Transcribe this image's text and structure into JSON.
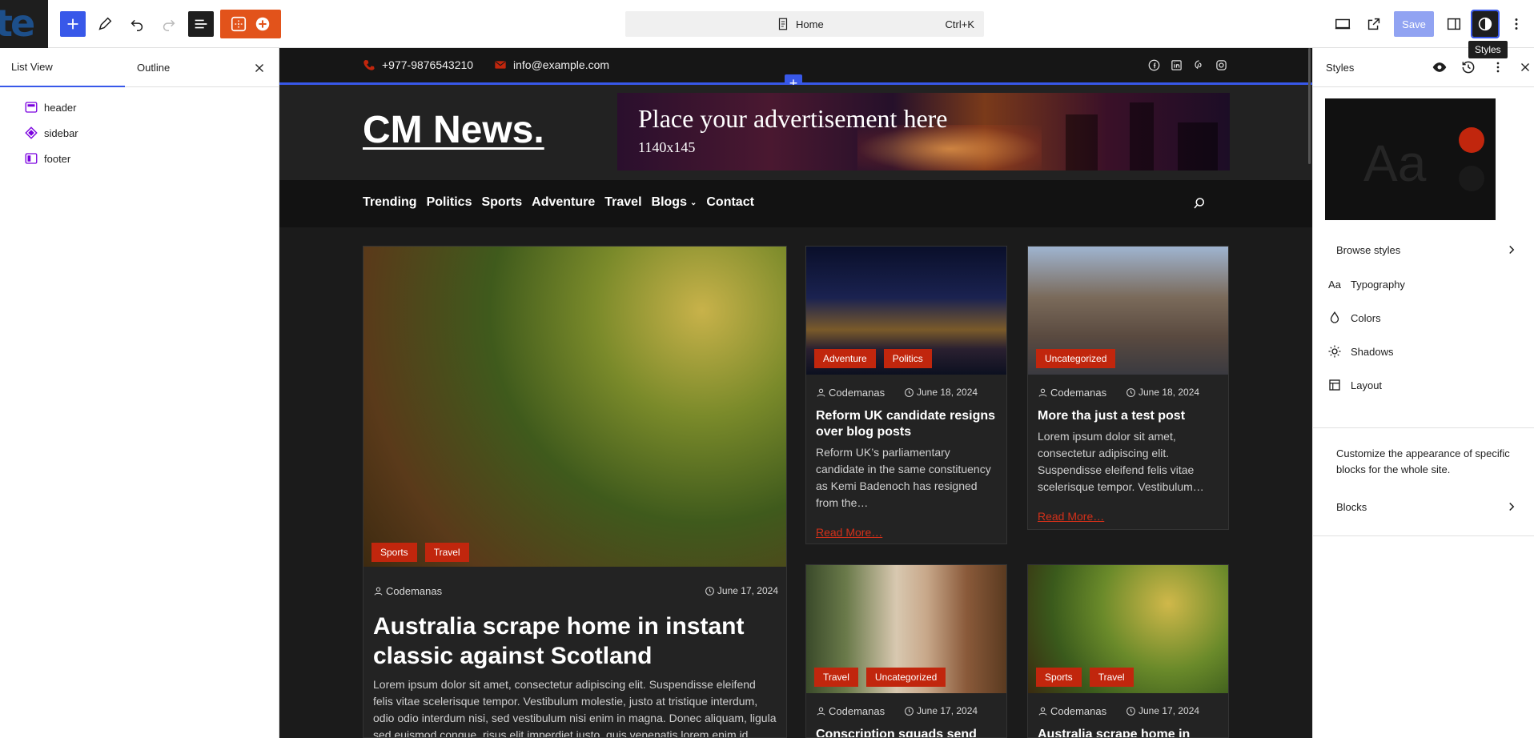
{
  "toolbar": {
    "logo_text": "te",
    "command_title": "Home",
    "command_shortcut": "Ctrl+K",
    "save_label": "Save",
    "tooltip": "Styles"
  },
  "list_view": {
    "tabs": [
      {
        "label": "List View"
      },
      {
        "label": "Outline"
      }
    ],
    "items": [
      {
        "label": "header",
        "icon": "template-part-header-icon"
      },
      {
        "label": "sidebar",
        "icon": "template-part-sidebar-icon"
      },
      {
        "label": "footer",
        "icon": "template-part-footer-icon"
      }
    ]
  },
  "site": {
    "phone": "+977-9876543210",
    "email": "info@example.com",
    "socials": [
      "facebook-icon",
      "linkedin-icon",
      "pinterest-icon",
      "instagram-icon"
    ],
    "title": "CM News.",
    "ad_title": "Place your advertisement here",
    "ad_size": "1140x145",
    "nav": [
      "Trending",
      "Politics",
      "Sports",
      "Adventure",
      "Travel",
      "Blogs",
      "Contact"
    ],
    "accent": "#c1260d"
  },
  "posts": {
    "featured": {
      "tags": [
        "Sports",
        "Travel"
      ],
      "author": "Codemanas",
      "date": "June 17, 2024",
      "title": "Australia scrape home in instant classic against Scotland",
      "excerpt": "Lorem ipsum dolor sit amet, consectetur adipiscing elit. Suspendisse eleifend felis vitae scelerisque tempor. Vestibulum molestie, justo at tristique interdum, odio odio interdum nisi, sed vestibulum nisi enim in magna. Donec aliquam, ligula sed euismod congue, risus elit imperdiet justo, quis venenatis lorem enim id"
    },
    "cards": [
      {
        "tags": [
          "Adventure",
          "Politics"
        ],
        "author": "Codemanas",
        "date": "June 18, 2024",
        "title": "Reform UK candidate resigns over blog posts",
        "excerpt": "Reform UK’s parliamentary candidate in the same constituency as Kemi Badenoch has resigned from the…",
        "read_more": "Read More…"
      },
      {
        "tags": [
          "Uncategorized"
        ],
        "author": "Codemanas",
        "date": "June 18, 2024",
        "title": "More tha just a test post",
        "excerpt": "Lorem ipsum dolor sit amet, consectetur adipiscing elit. Suspendisse eleifend felis vitae scelerisque tempor. Vestibulum…",
        "read_more": "Read More…"
      },
      {
        "tags": [
          "Travel",
          "Uncategorized"
        ],
        "author": "Codemanas",
        "date": "June 17, 2024",
        "title": "Conscription squads send",
        "excerpt": "",
        "read_more": ""
      },
      {
        "tags": [
          "Sports",
          "Travel"
        ],
        "author": "Codemanas",
        "date": "June 17, 2024",
        "title": "Australia scrape home in",
        "excerpt": "",
        "read_more": ""
      }
    ]
  },
  "styles_panel": {
    "title": "Styles",
    "preview_text": "Aa",
    "browse": "Browse styles",
    "items": [
      {
        "label": "Typography",
        "icon": "typography-icon"
      },
      {
        "label": "Colors",
        "icon": "colors-icon"
      },
      {
        "label": "Shadows",
        "icon": "shadows-icon"
      },
      {
        "label": "Layout",
        "icon": "layout-icon"
      }
    ],
    "description": "Customize the appearance of specific blocks for the whole site.",
    "blocks": "Blocks"
  }
}
